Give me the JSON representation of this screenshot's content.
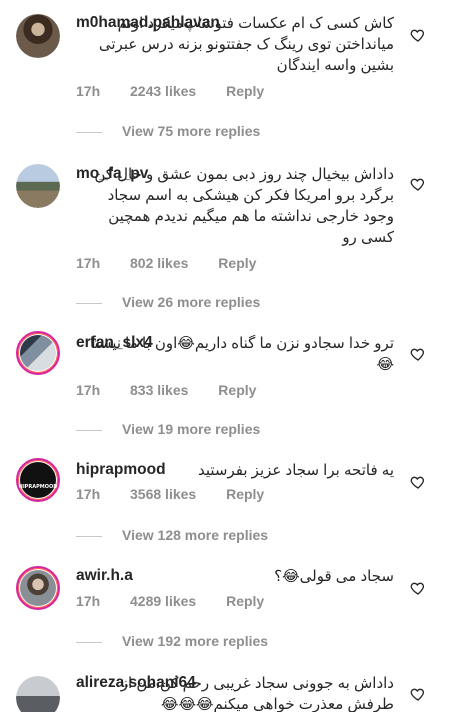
{
  "comments": [
    {
      "username": "m0hamad.pahlavan",
      "text": "کاش کسی ک ام عکسات فتوشاپ‌میکرد اونم میانداختن توی رینگ ک جفتتونو بزنه درس عبرتی بشین واسه ایندگان",
      "time": "17h",
      "likes": "2243 likes",
      "reply": "Reply",
      "more_replies": "View 75 more replies"
    },
    {
      "username": "mo_fa_pv",
      "text": "داداش بیخیال چند روز دبی بمون عشق و حال کن برگرد برو امریکا فکر کن هیشکی به اسم سجاد وجود خارجی نداشته ما هم میگیم ندیدم همچین کسی رو",
      "time": "17h",
      "likes": "802 likes",
      "reply": "Reply",
      "more_replies": "View 26 more replies"
    },
    {
      "username": "erfan_slx4",
      "text": "ترو خدا سجادو نزن ما گناه داریم😂اون با ما نیستا😂",
      "time": "17h",
      "likes": "833 likes",
      "reply": "Reply",
      "more_replies": "View 19 more replies"
    },
    {
      "username": "hiprapmood",
      "text": "یه فاتحه برا سجاد عزیز بفرستید",
      "time": "17h",
      "likes": "3568 likes",
      "reply": "Reply",
      "more_replies": "View 128 more replies",
      "avatar_text": "HIPRAPMOOD"
    },
    {
      "username": "awir.h.a",
      "text": "سجاد می قولی😂؟",
      "time": "17h",
      "likes": "4289 likes",
      "reply": "Reply",
      "more_replies": "View 192 more replies"
    },
    {
      "username": "alireza.sohani64",
      "text": "داداش به جوونی سجاد غریبی رحم کن.من از طرفش معذرت خواهی میکنم😂😂😂"
    }
  ],
  "icons": {
    "like": "heart-outline-icon"
  },
  "colors": {
    "username": "#262626",
    "meta": "#8e8e8e",
    "story_ring": "#d6249f"
  }
}
